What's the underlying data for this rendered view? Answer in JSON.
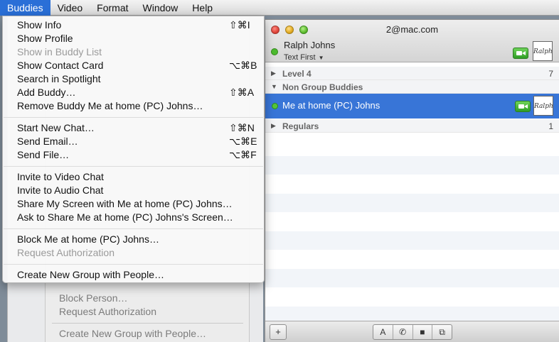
{
  "menubar": {
    "items": [
      "Buddies",
      "Video",
      "Format",
      "Window",
      "Help"
    ]
  },
  "buddies_menu": {
    "groups": [
      [
        {
          "label": "Show Info",
          "shortcut": "⇧⌘I",
          "enabled": true
        },
        {
          "label": "Show Profile",
          "shortcut": "",
          "enabled": true
        },
        {
          "label": "Show in Buddy List",
          "shortcut": "",
          "enabled": false
        },
        {
          "label": "Show Contact Card",
          "shortcut": "⌥⌘B",
          "enabled": true
        },
        {
          "label": "Search in Spotlight",
          "shortcut": "",
          "enabled": true
        },
        {
          "label": "Add Buddy…",
          "shortcut": "⇧⌘A",
          "enabled": true
        },
        {
          "label": "Remove Buddy Me at home (PC) Johns…",
          "shortcut": "",
          "enabled": true
        }
      ],
      [
        {
          "label": "Start New Chat…",
          "shortcut": "⇧⌘N",
          "enabled": true
        },
        {
          "label": "Send Email…",
          "shortcut": "⌥⌘E",
          "enabled": true
        },
        {
          "label": "Send File…",
          "shortcut": "⌥⌘F",
          "enabled": true
        }
      ],
      [
        {
          "label": "Invite to Video Chat",
          "shortcut": "",
          "enabled": true
        },
        {
          "label": "Invite to Audio Chat",
          "shortcut": "",
          "enabled": true
        },
        {
          "label": "Share My Screen with Me at home (PC) Johns…",
          "shortcut": "",
          "enabled": true
        },
        {
          "label": "Ask to Share Me at home (PC) Johns's Screen…",
          "shortcut": "",
          "enabled": true
        }
      ],
      [
        {
          "label": "Block Me at home (PC) Johns…",
          "shortcut": "",
          "enabled": true
        },
        {
          "label": "Request Authorization",
          "shortcut": "",
          "enabled": false
        }
      ],
      [
        {
          "label": "Create New Group with People…",
          "shortcut": "",
          "enabled": true
        }
      ]
    ]
  },
  "background_menu": {
    "items": [
      "Block Person…",
      "Request Authorization",
      "Create New Group with People…"
    ]
  },
  "buddy_window": {
    "title": "2@mac.com",
    "me": {
      "name": "Ralph Johns",
      "status": "Text First",
      "icon_text": "Ralph"
    },
    "groups": [
      {
        "name": "Level 4",
        "count": "7",
        "expanded": false
      },
      {
        "name": "Non Group Buddies",
        "count": "",
        "expanded": true
      },
      {
        "name": "Regulars",
        "count": "1",
        "expanded": false
      }
    ],
    "selected_buddy": {
      "name": "Me at home (PC) Johns",
      "icon_text": "Ralph"
    },
    "toolbar": {
      "add": "+",
      "text": "A",
      "audio": "✆",
      "video": "■",
      "screen": "⧉"
    }
  },
  "colors": {
    "menu_highlight": "#2a6fd7",
    "selection": "#3875d7",
    "online_green": "#4dbb2f"
  }
}
